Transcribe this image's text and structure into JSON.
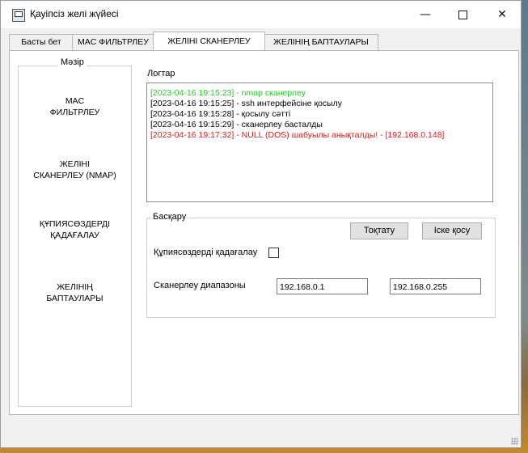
{
  "window": {
    "title": "Қауіпсіз желі жүйесі"
  },
  "tabs": [
    {
      "label": "Басты бет"
    },
    {
      "label": "MAC ФИЛЬТРЛЕУ"
    },
    {
      "label": "ЖЕЛІНІ  СКАНЕРЛЕУ"
    },
    {
      "label": "ЖЕЛІНІҢ  БАПТАУЛАРЫ"
    }
  ],
  "sidebar": {
    "title": "Мәзір",
    "items": [
      {
        "label": "MAC\nФИЛЬТРЛЕУ"
      },
      {
        "label": "ЖЕЛІНІ\nСКАНЕРЛЕУ (NMAP)"
      },
      {
        "label": "ҚҰПИЯСӨЗДЕРДІ\nҚАДАҒАЛАУ"
      },
      {
        "label": "ЖЕЛІНІҢ\nБАПТАУЛАРЫ"
      }
    ]
  },
  "logs": {
    "label": "Логтар",
    "colors": {
      "success": "#22cc22",
      "info": "#000000",
      "alert": "#e01818"
    },
    "lines": [
      {
        "text": "[2023-04-16 19:15:23] - nmap сканерлеу",
        "level": "success"
      },
      {
        "text": "[2023-04-16 19:15:25] - ssh интерфейсіне қосылу",
        "level": "info"
      },
      {
        "text": "[2023-04-16 19:15:28] - қосылу сәтті",
        "level": "info"
      },
      {
        "text": "[2023-04-16 19:15:29] - сканерлеу басталды",
        "level": "info"
      },
      {
        "text": "[2023-04-16 19:17:32] - NULL (DOS) шабуылы анықталды! - [192.168.0.148]",
        "level": "alert"
      }
    ]
  },
  "control": {
    "title": "Басқару",
    "stop_label": "Тоқтату",
    "start_label": "Іске қосу",
    "password_monitor_label": "Құпиясөздерді қадағалау",
    "password_monitor_checked": false,
    "scan_range_label": "Сканерлеу диапазоны",
    "range_start": "192.168.0.1",
    "range_end": "192.168.0.255"
  }
}
